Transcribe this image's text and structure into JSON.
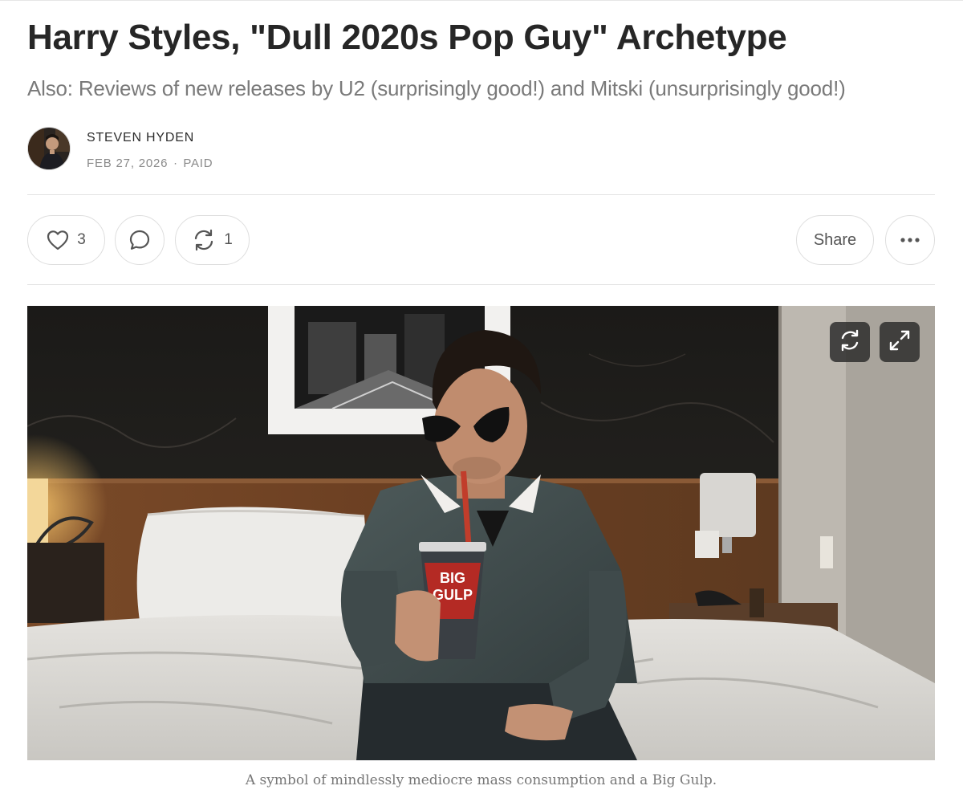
{
  "post": {
    "title": "Harry Styles, \"Dull 2020s Pop Guy\" Archetype",
    "subtitle": "Also: Reviews of new releases by U2 (surprisingly good!) and Mitski (unsurprisingly good!)",
    "author": "STEVEN HYDEN",
    "date": "FEB 27, 2026",
    "separator": "∙",
    "access": "PAID"
  },
  "actions": {
    "like_count": "3",
    "restack_count": "1",
    "share_label": "Share",
    "like_icon": "heart-icon",
    "comment_icon": "comment-icon",
    "restack_icon": "restack-icon",
    "more_icon": "more-icon"
  },
  "figure": {
    "caption": "A symbol of mindlessly mediocre mass consumption and a Big Gulp.",
    "cup_text_1": "BIG",
    "cup_text_2": "GULP",
    "refresh_icon": "refresh-icon",
    "expand_icon": "expand-icon"
  }
}
